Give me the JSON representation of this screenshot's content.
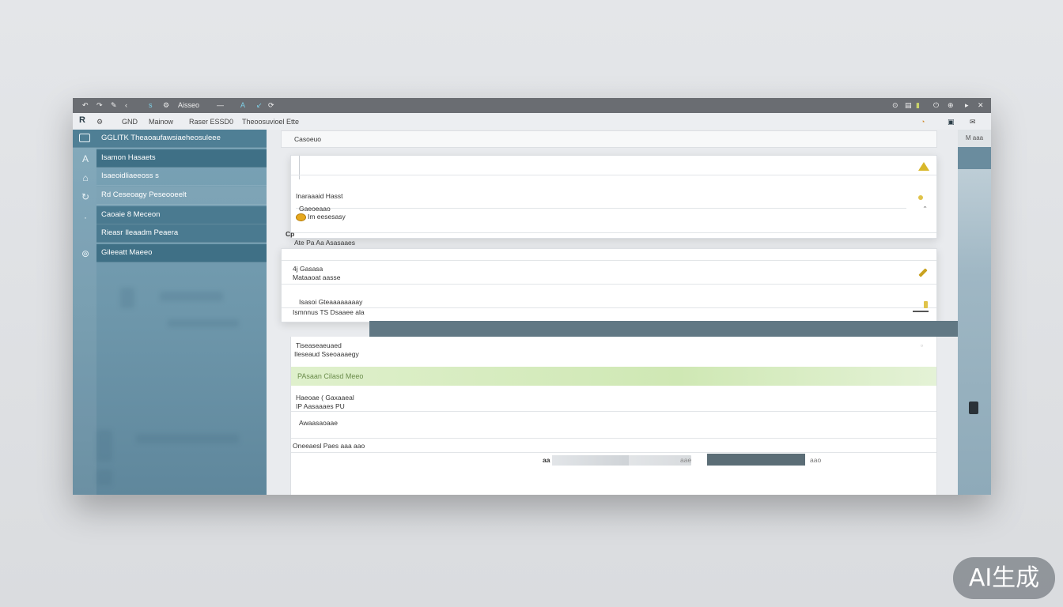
{
  "titlebar": {
    "items": [
      "↶",
      "↷",
      "✎",
      "‹",
      "s",
      "⚙"
    ],
    "title": "Aisseo",
    "tools": [
      "—",
      "A",
      "↙",
      "⟳"
    ],
    "right_icons": [
      "⊙",
      "▤",
      "▮",
      "⏻",
      "⊕",
      "▸",
      "✕"
    ]
  },
  "menubar": {
    "logo": "R",
    "items": [
      "⚙",
      "GND",
      "Mainow",
      "Raser ESSD0",
      "Theoosuvioel Ette"
    ],
    "right_icons": [
      "◔",
      "▣",
      "✉"
    ]
  },
  "sidebar": {
    "header": "GGLITK Theaoaufawsiaeheosuleee",
    "items": [
      {
        "label": "Isamon  Hasaets",
        "icon": "A"
      },
      {
        "label": "Isaeoidliaeeoss s",
        "icon": "⌂"
      },
      {
        "label": "Rd Ceseoagy Peseooeelt",
        "icon": "↻"
      },
      {
        "label": "Caoaie 8 Meceon",
        "icon": "·"
      },
      {
        "label": "Rieasr Ileaadm Peaera",
        "icon": ""
      },
      {
        "label": "Gileeatt Maeeo",
        "icon": "⊚"
      }
    ]
  },
  "main": {
    "header": "Casoeuo",
    "card1": {
      "row1": "Inaraaaid Hasst",
      "row2a": "Gaeoeaao",
      "row2b": "Im eesesasy",
      "row3": "Cp",
      "row3b": "Ate Pa Aa Asasaaes"
    },
    "card2": {
      "row1a": "4j Gasasa",
      "row1b": "Mataaoat aasse",
      "row2a": "Isasoi Gteaaaaaaaay",
      "row2b": "Ismnnus TS Dsaaee ala"
    },
    "rows": {
      "r1a": "Tiseaseaeuaed",
      "r1b": "Ileseaud Sseoaaaegy",
      "green": "PAsaan Cilasd Meeo",
      "r2a": "Haeoae ( Gaxaaeal",
      "r2b": "IP Aasaaaes PU",
      "r3": "Awaasaoaae",
      "footer": "Oneeaesl Paes aaa aao"
    },
    "bottom": {
      "left_label": "aa",
      "mid_label": "aae",
      "right_label": "aao",
      "progress": 0.55
    },
    "rightstrip_header": "M aaa"
  },
  "badge": "AI生成"
}
